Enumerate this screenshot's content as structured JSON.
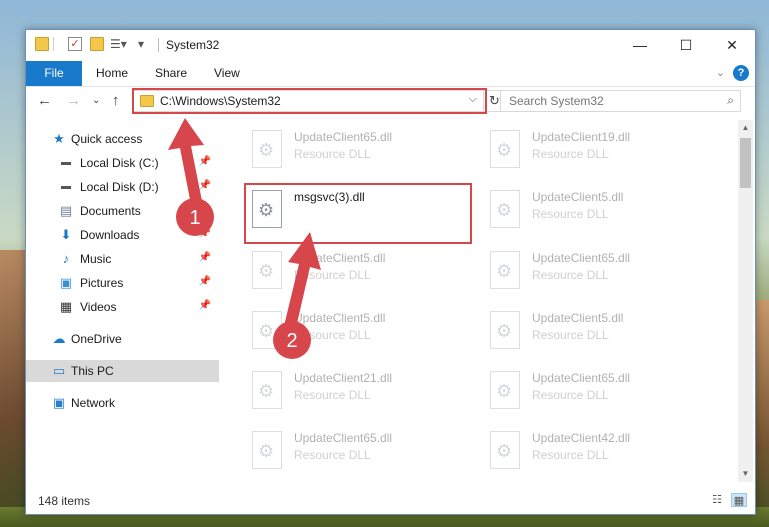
{
  "window": {
    "title": "System32",
    "minimize_label": "—",
    "maximize_label": "☐",
    "close_label": "✕"
  },
  "ribbon": {
    "file_tab": "File",
    "tabs": [
      "Home",
      "Share",
      "View"
    ],
    "help_label": "?"
  },
  "address": {
    "path": "C:\\Windows\\System32",
    "dropdown_label": "⌵",
    "refresh_label": "↻"
  },
  "search": {
    "placeholder": "Search System32"
  },
  "sidebar": {
    "items": [
      {
        "label": "Quick access",
        "icon": "star-icon"
      },
      {
        "label": "Local Disk (C:)",
        "icon": "drive-icon"
      },
      {
        "label": "Local Disk (D:)",
        "icon": "drive-icon"
      },
      {
        "label": "Documents",
        "icon": "documents-icon"
      },
      {
        "label": "Downloads",
        "icon": "download-icon"
      },
      {
        "label": "Music",
        "icon": "music-icon"
      },
      {
        "label": "Pictures",
        "icon": "pictures-icon"
      },
      {
        "label": "Videos",
        "icon": "videos-icon"
      },
      {
        "label": "OneDrive",
        "icon": "cloud-icon"
      },
      {
        "label": "This PC",
        "icon": "monitor-icon"
      },
      {
        "label": "Network",
        "icon": "network-icon"
      }
    ]
  },
  "files": {
    "left": [
      {
        "name": "UpdateClient65.dll",
        "type": "Resource DLL"
      },
      {
        "name": "msgsvc(3).dll",
        "type": ""
      },
      {
        "name": "UpdateClient5.dll",
        "type": "Resource DLL"
      },
      {
        "name": "UpdateClient5.dll",
        "type": "Resource DLL"
      },
      {
        "name": "UpdateClient21.dll",
        "type": "Resource DLL"
      },
      {
        "name": "UpdateClient65.dll",
        "type": "Resource DLL"
      }
    ],
    "right": [
      {
        "name": "UpdateClient19.dll",
        "type": "Resource DLL"
      },
      {
        "name": "UpdateClient5.dll",
        "type": "Resource DLL"
      },
      {
        "name": "UpdateClient65.dll",
        "type": "Resource DLL"
      },
      {
        "name": "UpdateClient5.dll",
        "type": "Resource DLL"
      },
      {
        "name": "UpdateClient65.dll",
        "type": "Resource DLL"
      },
      {
        "name": "UpdateClient42.dll",
        "type": "Resource DLL"
      }
    ]
  },
  "annotations": {
    "step1": "1",
    "step2": "2",
    "color": "#d6464b"
  },
  "status": {
    "item_count": "148 items"
  }
}
